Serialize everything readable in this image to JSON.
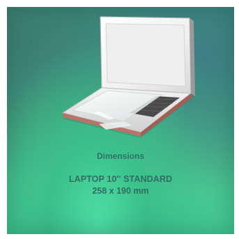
{
  "product": {
    "image_alt_icon": "laptop-icon",
    "section_label": "Dimensions",
    "model_label": "LAPTOP 10'' STANDARD",
    "size_label": "258 x 190 mm"
  },
  "colors": {
    "background_primary": "#47b082",
    "text": "#2f6e62",
    "laptop_body": "#e6e6e6",
    "laptop_screen": "#ededed"
  }
}
